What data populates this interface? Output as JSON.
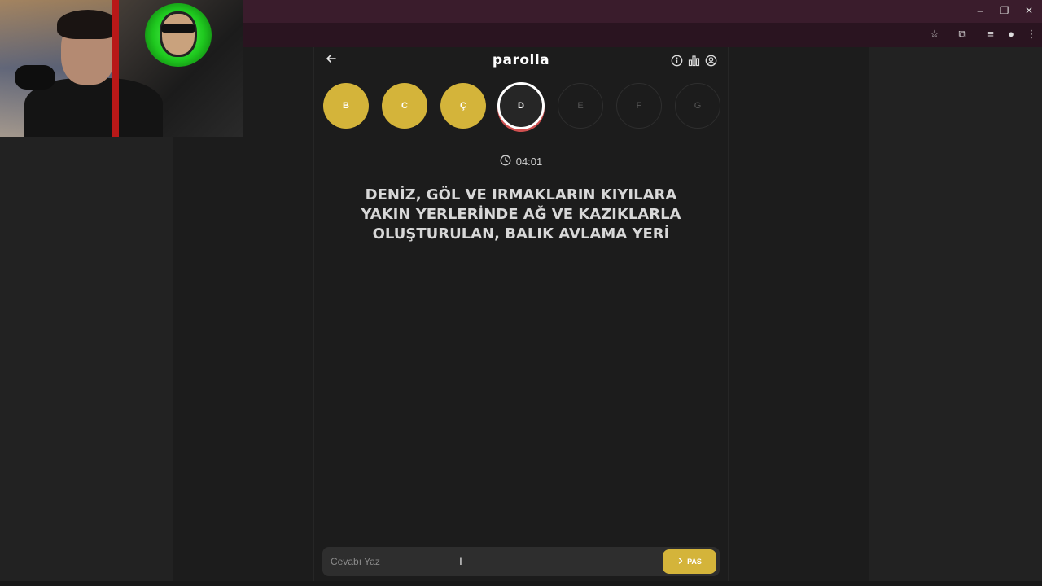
{
  "app": {
    "title": "parolla"
  },
  "letters": [
    {
      "letter": "B",
      "state": "done"
    },
    {
      "letter": "C",
      "state": "done"
    },
    {
      "letter": "Ç",
      "state": "done"
    },
    {
      "letter": "D",
      "state": "active"
    },
    {
      "letter": "E",
      "state": "pending"
    },
    {
      "letter": "F",
      "state": "pending"
    },
    {
      "letter": "G",
      "state": "pending"
    }
  ],
  "timer": {
    "value": "04:01"
  },
  "question": {
    "text": "DENİZ, GÖL VE IRMAKLARIN KIYILARA YAKIN YERLERİNDE AĞ VE KAZIKLARLA OLUŞTURULAN, BALIK AVLAMA YERİ"
  },
  "answer": {
    "placeholder": "Cevabı Yaz",
    "value": ""
  },
  "pass_button": {
    "label": "PAS"
  },
  "colors": {
    "accent": "#d4b43a",
    "active_ring": "#ffffff",
    "active_shadow": "#d05050",
    "background": "#1c1c1c"
  },
  "icons": {
    "back": "arrow-left-icon",
    "info": "info-icon",
    "stats": "bar-chart-icon",
    "profile": "user-circle-icon",
    "timer": "clock-icon",
    "pass": "chevron-right-icon"
  }
}
